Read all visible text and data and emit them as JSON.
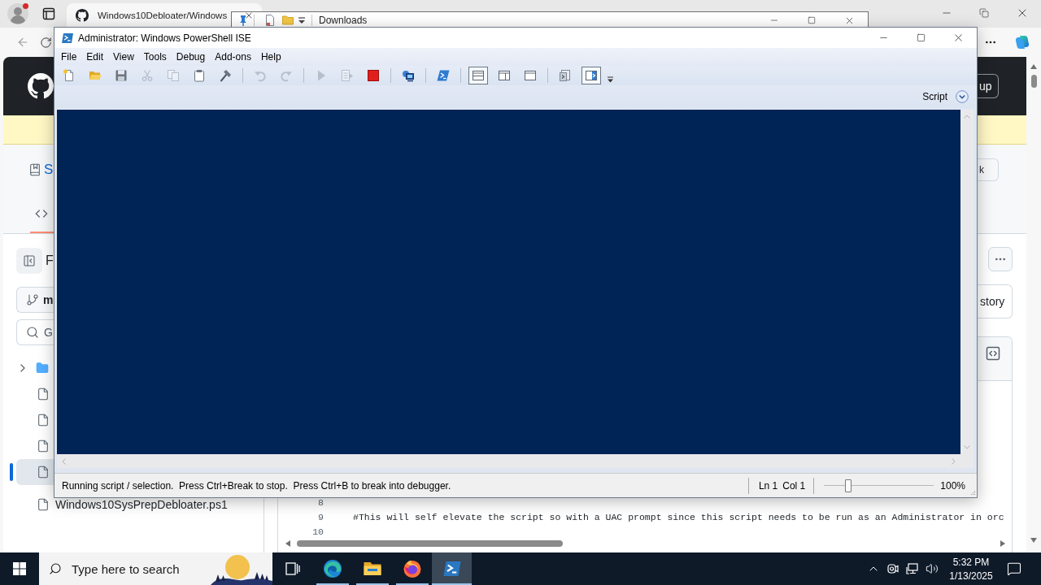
{
  "browser": {
    "tab": {
      "title": "Windows10Debloater/Windows",
      "selected": true
    },
    "page": {
      "header_button": "up",
      "repo_title": "S",
      "repo_button": "k",
      "code_tab": {
        "selected": true
      },
      "sidebar_title": "F",
      "branch_button": "m",
      "file_search_placeholder": "G",
      "tree": [
        {
          "kind": "folder",
          "expanded": false,
          "selected": false
        },
        {
          "kind": "file",
          "selected": false
        },
        {
          "kind": "file",
          "selected": false
        },
        {
          "kind": "file",
          "selected": false
        },
        {
          "kind": "file",
          "selected": true
        },
        {
          "kind": "file",
          "name": "Windows10SysPrepDebloater.ps1",
          "selected": false
        }
      ],
      "file_header_button": "story",
      "code_lines": [
        {
          "number": "8"
        },
        {
          "number": "9",
          "text": "#This will self elevate the script so with a UAC prompt since this script needs to be run as an Administrator in orc"
        },
        {
          "number": "10"
        }
      ]
    }
  },
  "explorer": {
    "title": "Downloads"
  },
  "ise": {
    "title": "Administrator: Windows PowerShell ISE",
    "menu": [
      "File",
      "Edit",
      "View",
      "Tools",
      "Debug",
      "Add-ons",
      "Help"
    ],
    "toolbar": [
      [
        {
          "disabled": false,
          "selected": false
        },
        {
          "disabled": false,
          "selected": false
        },
        {
          "disabled": false,
          "selected": false
        },
        {
          "disabled": true,
          "selected": false
        },
        {
          "disabled": true,
          "selected": false
        },
        {
          "disabled": false,
          "selected": false
        },
        {
          "disabled": false,
          "selected": false
        }
      ],
      [
        {
          "disabled": true,
          "selected": false
        },
        {
          "disabled": true,
          "selected": false
        }
      ],
      [
        {
          "disabled": true,
          "selected": false
        },
        {
          "disabled": true,
          "selected": false
        },
        {
          "disabled": false,
          "selected": false
        }
      ],
      [
        {
          "disabled": false,
          "selected": false
        }
      ],
      [
        {
          "disabled": false,
          "selected": false
        }
      ],
      [
        {
          "disabled": false,
          "selected": true
        },
        {
          "disabled": false,
          "selected": false
        },
        {
          "disabled": false,
          "selected": false
        }
      ],
      [
        {
          "disabled": false,
          "selected": false
        },
        {
          "disabled": false,
          "selected": true
        }
      ]
    ],
    "pane_toggle": "Script",
    "status": "Running script / selection.  Press Ctrl+Break to stop.  Press Ctrl+B to break into debugger.",
    "line": "Ln 1",
    "column": "Col 1",
    "zoom": {
      "level": 0.2,
      "reading": "100%"
    }
  },
  "taskbar": {
    "search_placeholder": "Type here to search",
    "apps": [
      {
        "kind": "edge",
        "running": true,
        "selected": false
      },
      {
        "kind": "explorer",
        "running": true,
        "selected": false
      },
      {
        "kind": "firefox",
        "running": true,
        "selected": false
      },
      {
        "kind": "ise",
        "running": true,
        "selected": true
      }
    ],
    "time": "5:32 PM",
    "date": "1/13/2025"
  }
}
